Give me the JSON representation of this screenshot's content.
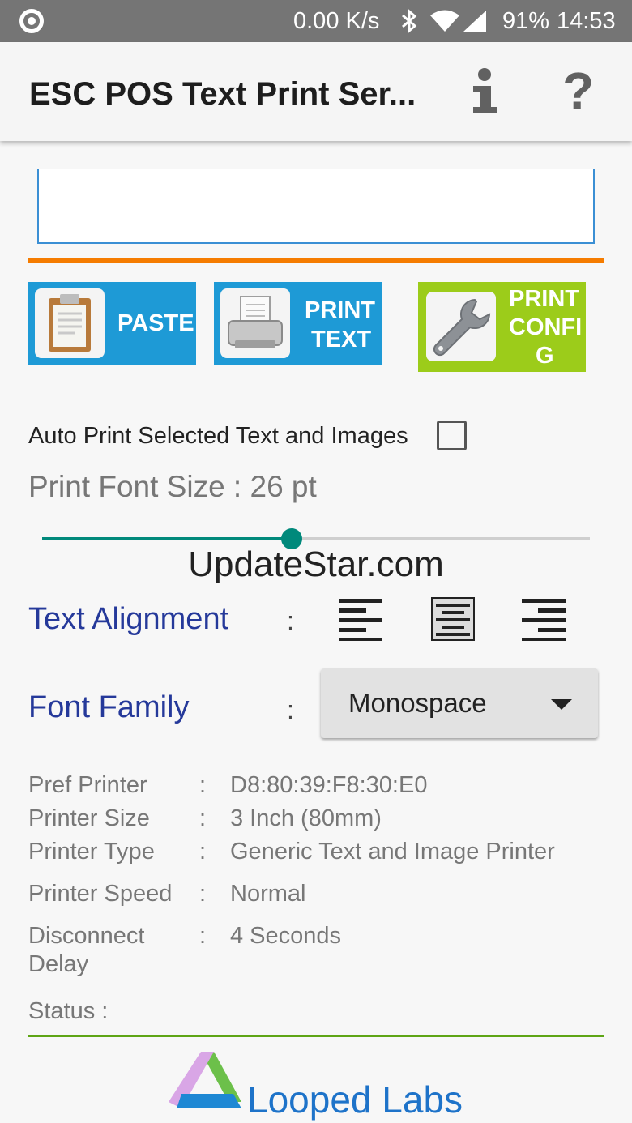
{
  "status_bar": {
    "net_speed": "0.00 K/s",
    "battery": "91%",
    "time": "14:53",
    "icons": [
      "radio-icon",
      "bluetooth-icon",
      "wifi-icon",
      "signal-icon"
    ]
  },
  "app_bar": {
    "title": "ESC POS Text Print Ser...",
    "help_glyph": "?",
    "icons": [
      "info-icon",
      "help-icon"
    ]
  },
  "actions": {
    "paste_label": "PASTE",
    "print_text_label_1": "PRINT",
    "print_text_label_2": "TEXT",
    "print_config_label_1": "PRINT",
    "print_config_label_2": "CONFI",
    "print_config_label_3": "G",
    "icons": [
      "clipboard-icon",
      "printer-icon",
      "wrench-icon"
    ]
  },
  "auto_print": {
    "label": "Auto Print Selected Text and Images",
    "checked": false
  },
  "font_size": {
    "label": "Print Font Size : 26 pt",
    "slider_fraction": 0.455
  },
  "watermark": "UpdateStar.com",
  "text_alignment": {
    "label": "Text Alignment",
    "separator": ":",
    "icons": [
      "align-left-icon",
      "align-center-icon",
      "align-right-icon"
    ],
    "selected": "align-center"
  },
  "font_family": {
    "label": "Font Family",
    "separator": ":",
    "selected": "Monospace"
  },
  "details": [
    {
      "label": "Pref Printer",
      "sep": ":",
      "value": "D8:80:39:F8:30:E0"
    },
    {
      "label": "Printer Size",
      "sep": ":",
      "value": "3 Inch (80mm)"
    },
    {
      "label": "Printer Type",
      "sep": ":",
      "value": "Generic Text and Image Printer"
    },
    {
      "label": "Printer Speed",
      "sep": ":",
      "value": "Normal"
    },
    {
      "label": "Disconnect",
      "label2": "Delay",
      "sep": ":",
      "value": "4 Seconds"
    }
  ],
  "status": {
    "label": "Status :"
  },
  "footer": {
    "brand": "Looped Labs",
    "logo_icon": "looped-labs-logo-icon"
  },
  "colors": {
    "accent_blue": "#1e9ad6",
    "accent_green": "#9ccc1a",
    "divider_orange": "#f57c00",
    "divider_green": "#5ea515",
    "slider_teal": "#00897b",
    "label_navy": "#25399a"
  }
}
